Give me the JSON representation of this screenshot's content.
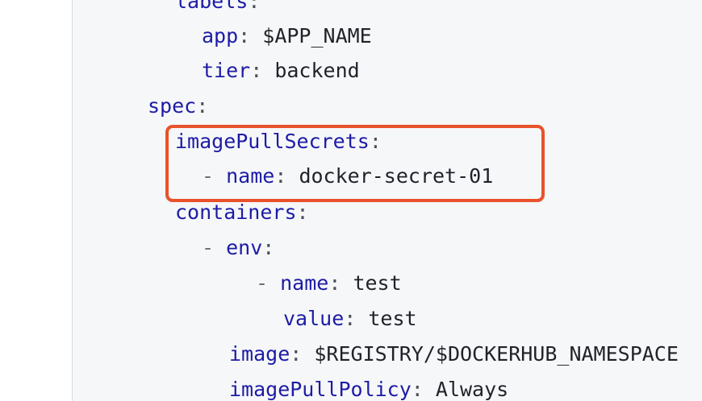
{
  "lines": [
    {
      "key": "labels",
      "dash": "",
      "value": ""
    },
    {
      "key": "app",
      "dash": "",
      "value": "$APP_NAME"
    },
    {
      "key": "tier",
      "dash": "",
      "value": "backend"
    },
    {
      "key": "spec",
      "dash": "",
      "value": ""
    },
    {
      "key": "imagePullSecrets",
      "dash": "",
      "value": ""
    },
    {
      "key": "name",
      "dash": "- ",
      "value": "docker-secret-01"
    },
    {
      "key": "containers",
      "dash": "",
      "value": ""
    },
    {
      "key": "env",
      "dash": "- ",
      "value": ""
    },
    {
      "key": "name",
      "dash": "- ",
      "value": "test"
    },
    {
      "key": "value",
      "dash": "",
      "value": "test"
    },
    {
      "key": "image",
      "dash": "",
      "value": "$REGISTRY/$DOCKERHUB_NAMESPACE"
    },
    {
      "key": "imagePullPolicy",
      "dash": "",
      "value": "Always"
    }
  ],
  "colors": {
    "key": "#1d1ca5",
    "text": "#1f2329",
    "highlight_border": "#e8522c",
    "panel_background": "#f6f7f9"
  }
}
